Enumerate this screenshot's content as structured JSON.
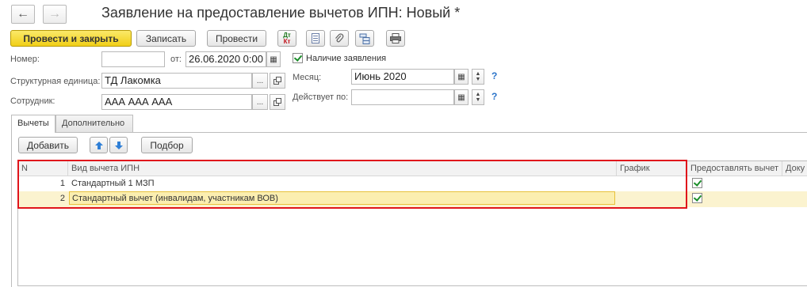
{
  "window": {
    "title": "Заявление на предоставление вычетов ИПН: Новый *"
  },
  "nav": {
    "back_glyph": "←",
    "forward_glyph": "→"
  },
  "toolbar": {
    "post_close": "Провести и закрыть",
    "save": "Записать",
    "post": "Провести",
    "dt_kt_top": "Дт",
    "dt_kt_bottom": "Кт"
  },
  "form": {
    "number_label": "Номер:",
    "number_value": "",
    "date_label": "от:",
    "date_value": "26.06.2020  0:00",
    "statement_checkbox_label": "Наличие заявления",
    "statement_checked": true,
    "unit_label": "Структурная единица:",
    "unit_value": "ТД Лакомка",
    "employee_label": "Сотрудник:",
    "employee_value": "ААА ААА ААА",
    "month_label": "Месяц:",
    "month_value": "Июнь 2020",
    "valid_label": "Действует по:",
    "valid_value": "",
    "help": "?",
    "select_glyph": "...",
    "calendar_glyph": "▦"
  },
  "tabs": [
    {
      "label": "Вычеты"
    },
    {
      "label": "Дополнительно"
    }
  ],
  "table_toolbar": {
    "add": "Добавить",
    "select": "Подбор"
  },
  "table": {
    "columns": [
      "N",
      "Вид вычета ИПН",
      "График",
      "Предоставлять вычет",
      "Доку"
    ],
    "rows": [
      {
        "n": "1",
        "type": "Стандартный 1 МЗП",
        "schedule": "",
        "provide": true
      },
      {
        "n": "2",
        "type": "Стандартный вычет (инвалидам, участникам ВОВ)",
        "schedule": "",
        "provide": true
      }
    ]
  },
  "colors": {
    "accent_yellow": "#f3d11e",
    "highlight_border": "#e0141b",
    "selected_row": "#fbf3cf"
  }
}
